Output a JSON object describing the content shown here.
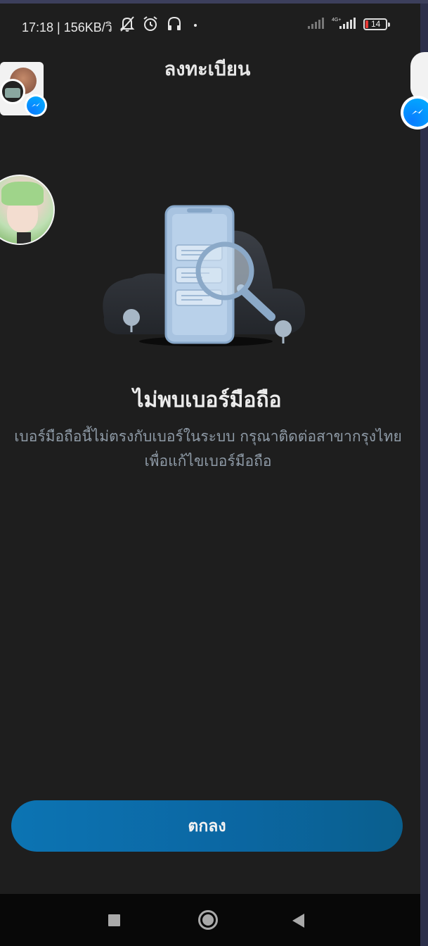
{
  "status_bar": {
    "time_and_speed": "17:18 | 156KB/วิ",
    "network_label": "4G+",
    "battery_level": "14",
    "battery_color": "#e53935"
  },
  "header": {
    "title": "ลงทะเบียน"
  },
  "content": {
    "heading": "ไม่พบเบอร์มือถือ",
    "message": "เบอร์มือถือนี้ไม่ตรงกับเบอร์ในระบบ กรุณาติดต่อสาขากรุงไทยเพื่อแก้ไขเบอร์มือถือ"
  },
  "actions": {
    "ok_label": "ตกลง",
    "button_color": "#0c74b3"
  },
  "icons": {
    "status": [
      "silent-bell-icon",
      "alarm-icon",
      "headset-icon"
    ],
    "illustration": "phone-search-illustration",
    "nav": [
      "recent-apps-icon",
      "home-icon",
      "back-icon"
    ]
  }
}
